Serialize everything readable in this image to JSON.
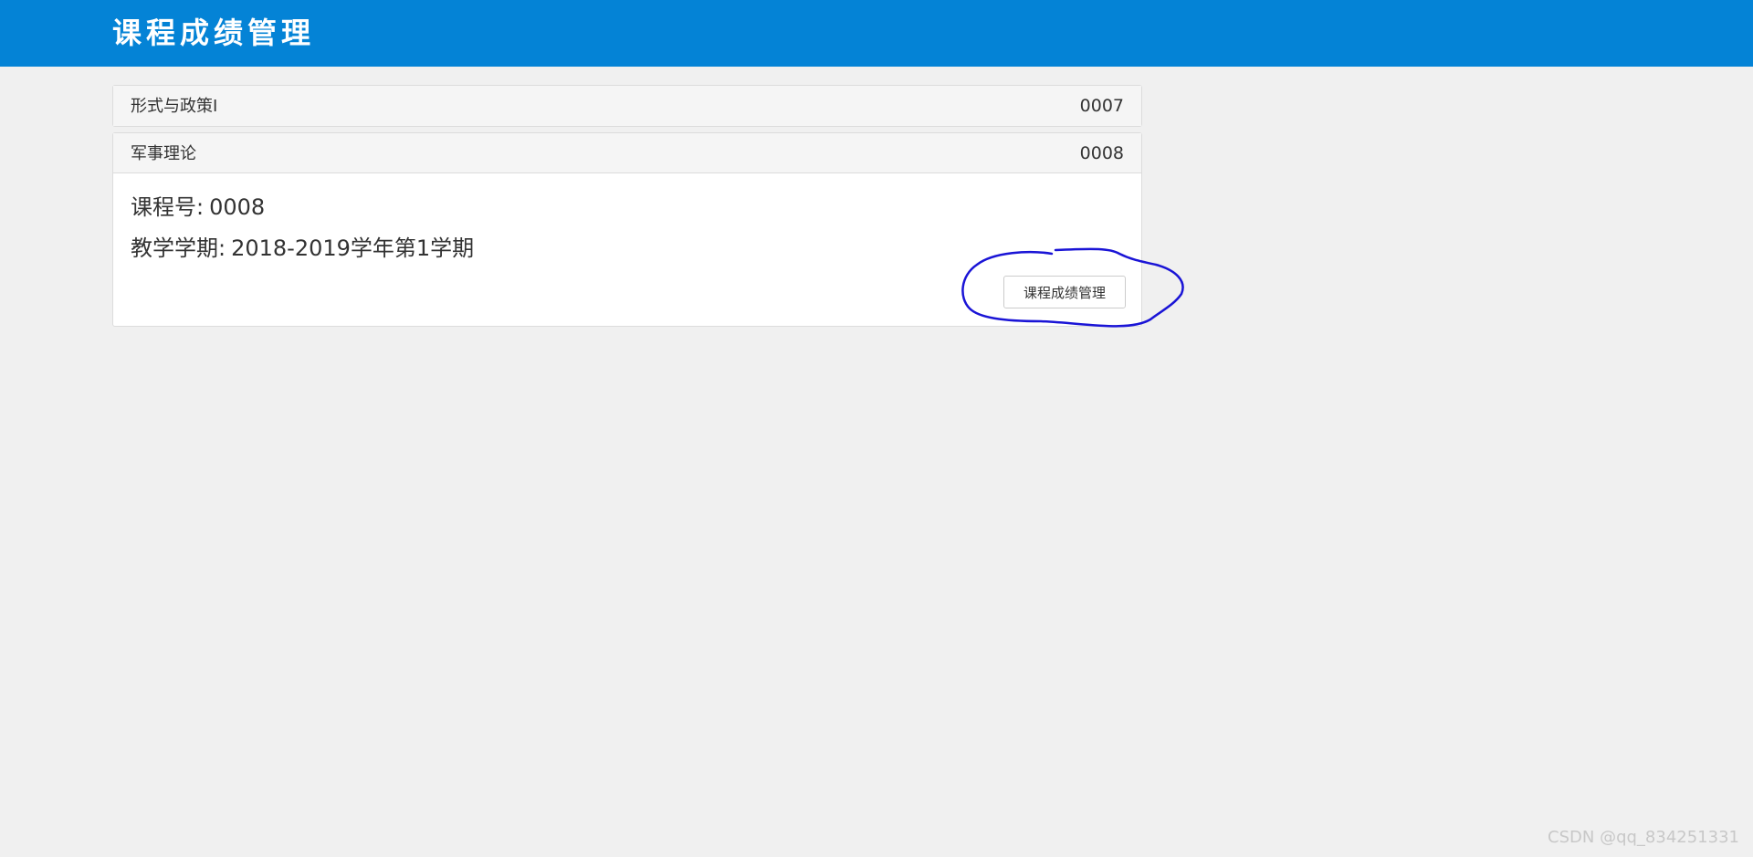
{
  "header": {
    "title": "课程成绩管理"
  },
  "courses": [
    {
      "name": "形式与政策I",
      "id": "0007",
      "expanded": false
    },
    {
      "name": "军事理论",
      "id": "0008",
      "expanded": true,
      "details": {
        "course_number_label": "课程号:",
        "course_number_value": "0008",
        "semester_label": "教学学期:",
        "semester_value": "2018-2019学年第1学期"
      },
      "action_button_label": "课程成绩管理"
    }
  ],
  "watermark": "CSDN @qq_834251331",
  "colors": {
    "header_bg": "#0483d6",
    "page_bg": "#f0f0f0",
    "annotation_stroke": "#1a14d6"
  }
}
